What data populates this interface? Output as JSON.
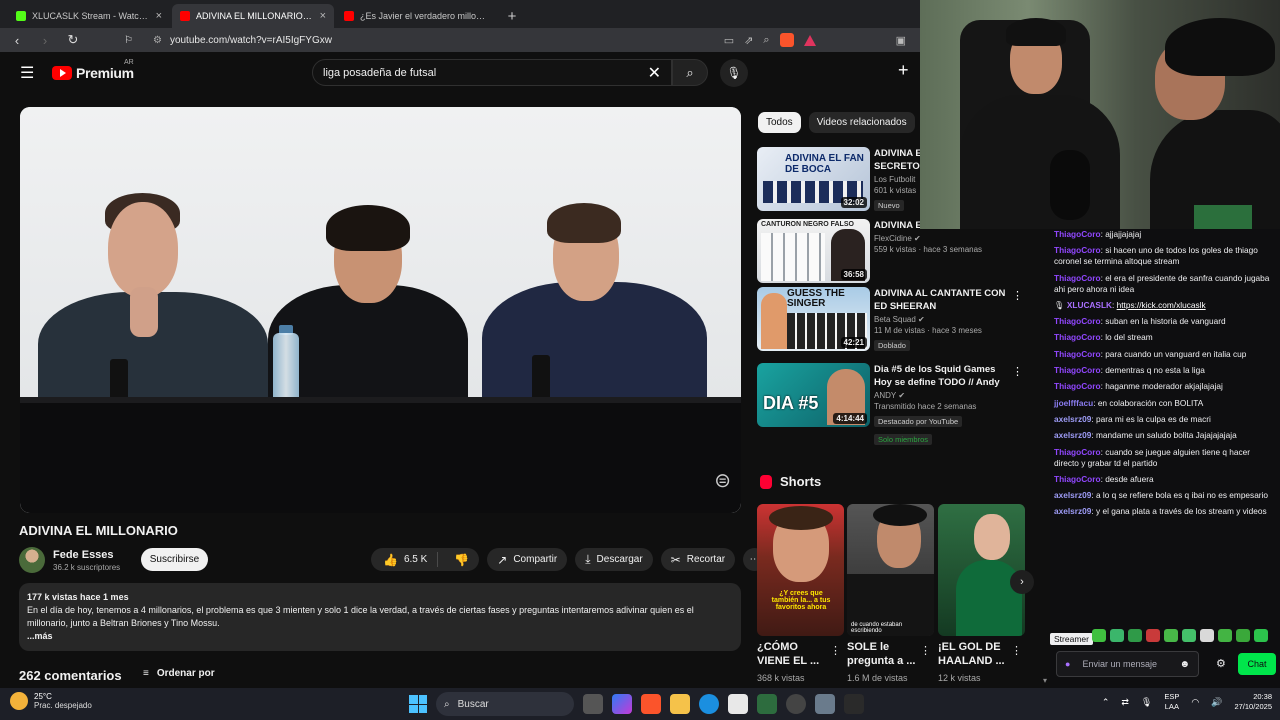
{
  "browser": {
    "tabs": [
      {
        "title": "XLUCASLK Stream - Watch Live on Ki",
        "fav_color": "#53fc18",
        "active": false
      },
      {
        "title": "ADIVINA EL MILLONARIO - YouT",
        "fav_color": "#ff0000",
        "active": true
      },
      {
        "title": "¿Es Javier el verdadero millonario? Ad",
        "fav_color": "#ff0000",
        "active": false
      }
    ],
    "new_tab": "+",
    "url": "youtube.com/watch?v=rAI5IgFYGxw"
  },
  "youtube": {
    "logo_text": "Premium",
    "country": "AR",
    "search_value": "liga posadeña de futsal",
    "video": {
      "title": "ADIVINA EL MILLONARIO",
      "channel": "Fede Esses",
      "subscribers": "36.2 k suscriptores",
      "subscribe_label": "Suscribirse",
      "likes": "6.5 K",
      "share_label": "Compartir",
      "download_label": "Descargar",
      "clip_label": "Recortar",
      "description_meta": "177 k vistas  hace 1 mes",
      "description": "En el día de hoy, tenemos a 4 millonarios, el problema es que 3 mienten y solo 1 dice la verdad, a través de ciertas fases y preguntas intentaremos adivinar quien es el millonario, junto a Beltran Briones y Tino Mossu.",
      "more_label": "...más",
      "comments_count": "262 comentarios",
      "sort_label": "Ordenar por"
    },
    "chips": [
      "Todos",
      "Videos relacionados"
    ],
    "related": [
      {
        "title": "ADIVINA EL",
        "title2": "SECRETO D",
        "channel": "Los Futbolit",
        "meta": "601 k vistas",
        "badge": "Nuevo",
        "duration": "32:02",
        "thumb_text": "ADIVINA EL FAN DE BOCA",
        "thumb_bg": "#c8d2e0"
      },
      {
        "title": "ADIVINA E",
        "title2": "",
        "channel": "FlexCidine",
        "meta": "559 k vistas · hace 3 semanas",
        "badge": "",
        "duration": "36:58",
        "thumb_text": "CANTURON NEGRO FALSO",
        "thumb_bg": "#dfe3e6"
      },
      {
        "title": "ADIVINA AL CANTANTE CON",
        "title2": "ED SHEERAN",
        "channel": "Beta Squad",
        "meta": "11 M de vistas · hace 3 meses",
        "badge": "Doblado",
        "duration": "42:21",
        "thumb_text": "GUESS THE SINGER",
        "thumb_bg": "#8fb3d1"
      },
      {
        "title": "Dia #5 de los Squid Games",
        "title2": "Hoy se define TODO // Andy",
        "channel": "ANDY",
        "meta": "Transmitido hace 2 semanas",
        "badge": "Destacado por YouTube",
        "badge2": "Solo miembros",
        "duration": "4:14:44",
        "thumb_text": "DIA #5",
        "thumb_bg": "#1b8c8a"
      }
    ],
    "shorts_label": "Shorts",
    "shorts": [
      {
        "title": "¿CÓMO VIENE EL ...",
        "views": "368 k vistas",
        "bg": "#7a2a1f",
        "caption": "¿Y crees que también la... a tus favoritos ahora"
      },
      {
        "title": "SOLE le pregunta a ...",
        "views": "1.6 M de vistas",
        "bg": "#3a3a3a",
        "caption": "de cuando estaban escribiendo"
      },
      {
        "title": "¡EL GOL DE HAALAND ...",
        "views": "12 k vistas",
        "bg": "#1f5a34",
        "caption": ""
      }
    ]
  },
  "chat": {
    "messages": [
      {
        "user": "ThiagoCoro",
        "color": "#9147ff",
        "text": "ajjajjajajaj"
      },
      {
        "user": "ThiagoCoro",
        "color": "#9147ff",
        "text": "si hacen uno de todos los goles de thiago coronel se termina altoque stream"
      },
      {
        "user": "ThiagoCoro",
        "color": "#9147ff",
        "text": "el era el presidente de sanfra cuando jugaba ahi pero ahora ni idea"
      },
      {
        "user": "XLUCASLK",
        "color": "#a970ff",
        "text": "https://kick.com/xlucaslk",
        "link": true
      },
      {
        "user": "ThiagoCoro",
        "color": "#9147ff",
        "text": "suban en la historia de vanguard"
      },
      {
        "user": "ThiagoCoro",
        "color": "#9147ff",
        "text": "lo del stream"
      },
      {
        "user": "ThiagoCoro",
        "color": "#9147ff",
        "text": "para cuando un vanguard en italia cup"
      },
      {
        "user": "ThiagoCoro",
        "color": "#9147ff",
        "text": "dementras q no esta la liga"
      },
      {
        "user": "ThiagoCoro",
        "color": "#9147ff",
        "text": "haganme moderador akjajlajajaj"
      },
      {
        "user": "jjoelfffacu",
        "color": "#8a7cf0",
        "text": "en colaboración con BOLITA"
      },
      {
        "user": "axelsrz09",
        "color": "#9e9cf7",
        "text": "para mi es la culpa es de macri"
      },
      {
        "user": "axelsrz09",
        "color": "#9e9cf7",
        "text": "mandame un saludo bolita Jajajajajaja"
      },
      {
        "user": "ThiagoCoro",
        "color": "#9147ff",
        "text": "cuando se juegue alguien tiene q hacer directo y grabar td el partido"
      },
      {
        "user": "ThiagoCoro",
        "color": "#9147ff",
        "text": "desde afuera"
      },
      {
        "user": "axelsrz09",
        "color": "#9e9cf7",
        "text": "a lo q se refiere bola es q ibai no es empesario"
      },
      {
        "user": "axelsrz09",
        "color": "#9e9cf7",
        "text": "y el gana plata a través de los stream y videos"
      }
    ],
    "streamer_tag": "Streamer",
    "input_placeholder": "Enviar un mensaje",
    "chat_button": "Chat"
  },
  "taskbar": {
    "temperature": "25°C",
    "weather": "Prac. despejado",
    "search_label": "Buscar",
    "lang_top": "ESP",
    "lang_bottom": "LAA",
    "time": "20:38",
    "date": "27/10/2025"
  }
}
